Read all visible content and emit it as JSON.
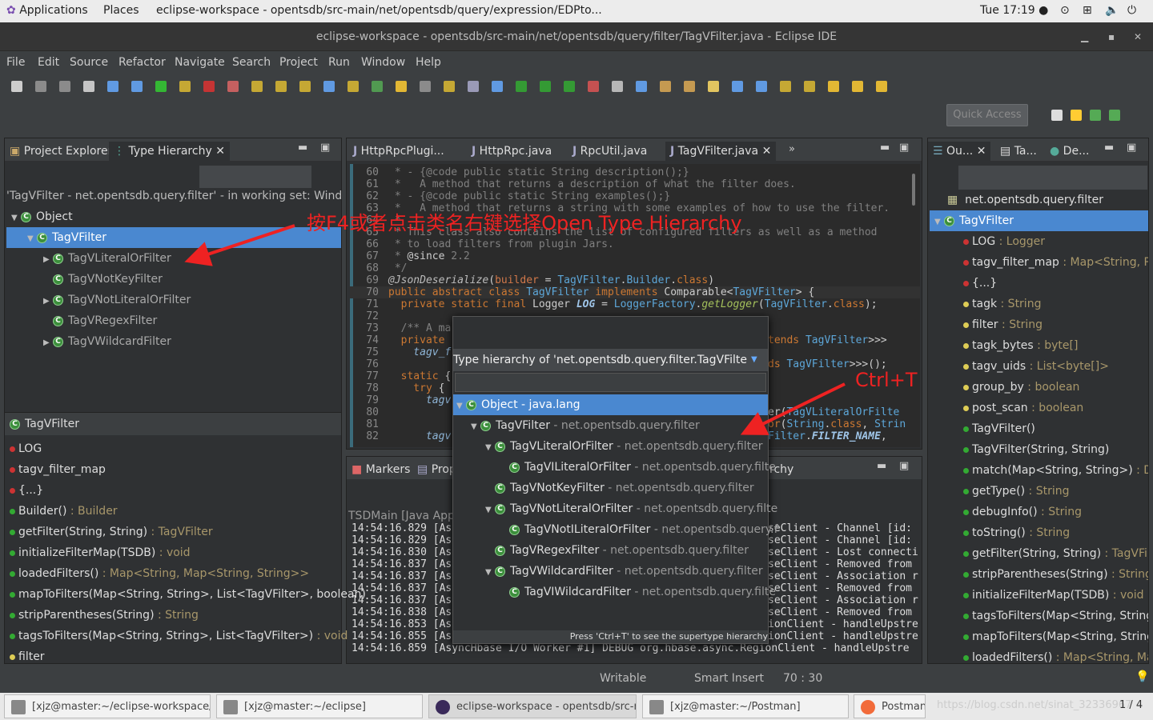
{
  "topbar": {
    "applications": "Applications",
    "places": "Places",
    "window": "eclipse-workspace - opentsdb/src-main/net/opentsdb/query/expression/EDPto...",
    "clock": "Tue 17:19 ●"
  },
  "window": {
    "title": "eclipse-workspace - opentsdb/src-main/net/opentsdb/query/filter/TagVFilter.java - Eclipse IDE"
  },
  "menu": [
    "File",
    "Edit",
    "Source",
    "Refactor",
    "Navigate",
    "Search",
    "Project",
    "Run",
    "Window",
    "Help"
  ],
  "toolbar": {
    "quick_access": "Quick Access"
  },
  "left_panel": {
    "tabs": [
      "Project Explorer",
      "Type Hierarchy"
    ],
    "status": "'TagVFilter - net.opentsdb.query.filter' - in working set: Window W",
    "tree": [
      {
        "label": "Object",
        "depth": 0,
        "exp": "down"
      },
      {
        "label": "TagVFilter",
        "depth": 1,
        "exp": "down",
        "sel": true
      },
      {
        "label": "TagVLiteralOrFilter",
        "depth": 2,
        "exp": "right"
      },
      {
        "label": "TagVNotKeyFilter",
        "depth": 2,
        "exp": ""
      },
      {
        "label": "TagVNotLiteralOrFilter",
        "depth": 2,
        "exp": "right"
      },
      {
        "label": "TagVRegexFilter",
        "depth": 2,
        "exp": ""
      },
      {
        "label": "TagVWildcardFilter",
        "depth": 2,
        "exp": "right"
      }
    ],
    "members_title": "TagVFilter",
    "members": [
      {
        "name": "LOG",
        "type": "",
        "color": "#c33"
      },
      {
        "name": "tagv_filter_map",
        "type": "",
        "color": "#c33"
      },
      {
        "name": "{...}",
        "type": "",
        "color": "#c33"
      },
      {
        "name": "Builder()",
        "type": " : Builder",
        "color": "#3a3"
      },
      {
        "name": "getFilter(String, String)",
        "type": " : TagVFilter",
        "color": "#3a3"
      },
      {
        "name": "initializeFilterMap(TSDB)",
        "type": " : void",
        "color": "#3a3"
      },
      {
        "name": "loadedFilters()",
        "type": " : Map<String, Map<String, String>>",
        "color": "#3a3"
      },
      {
        "name": "mapToFilters(Map<String, String>, List<TagVFilter>, boolean)",
        "type": "",
        "color": "#3a3"
      },
      {
        "name": "stripParentheses(String)",
        "type": " : String",
        "color": "#3a3"
      },
      {
        "name": "tagsToFilters(Map<String, String>, List<TagVFilter>)",
        "type": " : void",
        "color": "#3a3"
      },
      {
        "name": "filter",
        "type": "",
        "color": "#dc5"
      }
    ]
  },
  "editor": {
    "tabs": [
      "HttpRpcPlugi...",
      "HttpRpc.java",
      "RpcUtil.java",
      "TagVFilter.java"
    ],
    "lines": [
      {
        "n": "60",
        "t": [
          [
            "c",
            " * - {@code public static String description();}"
          ]
        ]
      },
      {
        "n": "61",
        "t": [
          [
            "c",
            " *   A method that returns a description of what the filter does."
          ]
        ]
      },
      {
        "n": "62",
        "t": [
          [
            "c",
            " * - {@code public static String examples();}"
          ]
        ]
      },
      {
        "n": "63",
        "t": [
          [
            "c",
            " *   A method that returns a string with some examples of how to use the filter."
          ]
        ]
      },
      {
        "n": "64",
        "t": [
          [
            "c",
            " *"
          ]
        ]
      },
      {
        "n": "65",
        "t": [
          [
            "c",
            " * This class also contains the list of configured filters as well as a method"
          ]
        ]
      },
      {
        "n": "66",
        "t": [
          [
            "c",
            " * to load filters from plugin Jars."
          ]
        ]
      },
      {
        "n": "67",
        "t": [
          [
            "c",
            " * "
          ],
          [
            "p",
            "@since"
          ],
          [
            "c",
            " 2.2"
          ]
        ]
      },
      {
        "n": "68",
        "t": [
          [
            "c",
            " */"
          ]
        ]
      },
      {
        "n": "69",
        "t": [
          [
            "a",
            "@JsonDeserialize"
          ],
          [
            "p",
            "("
          ],
          [
            "par",
            "builder"
          ],
          [
            "p",
            " = "
          ],
          [
            "ty",
            "TagVFilter"
          ],
          [
            "p",
            "."
          ],
          [
            "ty",
            "Builder"
          ],
          [
            "p",
            "."
          ],
          [
            "k",
            "class"
          ],
          [
            "p",
            ")"
          ]
        ]
      },
      {
        "n": "70",
        "t": [
          [
            "k",
            "public abstract class "
          ],
          [
            "ty",
            "TagVFilter"
          ],
          [
            "k",
            " implements "
          ],
          [
            "p",
            "Comparable<"
          ],
          [
            "ty",
            "TagVFilter"
          ],
          [
            "p",
            "> {"
          ]
        ]
      },
      {
        "n": "71",
        "t": [
          [
            "k",
            "  private static final "
          ],
          [
            "p",
            "Logger "
          ],
          [
            "bi",
            "LOG"
          ],
          [
            "p",
            " = "
          ],
          [
            "ty",
            "LoggerFactory"
          ],
          [
            "p",
            "."
          ],
          [
            "f",
            "getLogger"
          ],
          [
            "p",
            "("
          ],
          [
            "ty",
            "TagVFilter"
          ],
          [
            "p",
            "."
          ],
          [
            "k",
            "class"
          ],
          [
            "p",
            ");"
          ]
        ]
      },
      {
        "n": "72",
        "t": []
      },
      {
        "n": "73",
        "t": [
          [
            "c",
            "  /** A ma"
          ]
        ]
      },
      {
        "n": "74",
        "t": [
          [
            "k",
            "  private"
          ]
        ],
        "tail": [
          [
            "k",
            "tends "
          ],
          [
            "ty",
            "TagVFilter"
          ],
          [
            "p",
            ">>>"
          ]
        ]
      },
      {
        "n": "75",
        "t": [
          [
            "iv",
            "    tagv_f"
          ]
        ]
      },
      {
        "n": "76",
        "t": [],
        "tail": [
          [
            "k",
            "ds "
          ],
          [
            "ty",
            "TagVFilter"
          ],
          [
            "p",
            ">>>();"
          ]
        ]
      },
      {
        "n": "77",
        "t": [
          [
            "k",
            "  static"
          ],
          [
            "p",
            " {"
          ]
        ]
      },
      {
        "n": "78",
        "t": [
          [
            "k",
            "    try"
          ],
          [
            "p",
            " {"
          ]
        ]
      },
      {
        "n": "79",
        "t": [
          [
            "iv",
            "      tagv"
          ]
        ]
      },
      {
        "n": "80",
        "t": [],
        "tail": [
          [
            "p",
            "er("
          ],
          [
            "ty",
            "TagVLiteralOrFilte"
          ]
        ]
      },
      {
        "n": "81",
        "t": [],
        "tail": [
          [
            "k",
            "or"
          ],
          [
            "p",
            "("
          ],
          [
            "ty",
            "String"
          ],
          [
            "p",
            "."
          ],
          [
            "k",
            "class"
          ],
          [
            "p",
            ", "
          ],
          [
            "ty",
            "Strin"
          ]
        ]
      },
      {
        "n": "82",
        "t": [
          [
            "iv",
            "      tagv"
          ]
        ],
        "tail": [
          [
            "ty",
            "Filter"
          ],
          [
            "p",
            "."
          ],
          [
            "bi",
            "FILTER_NAME"
          ],
          [
            "p",
            ","
          ]
        ]
      }
    ]
  },
  "console": {
    "tabs": [
      "Markers",
      "Prop"
    ],
    "tab_tail": "rchy",
    "header": "TSDMain [Java Appli",
    "lines": [
      [
        "14:54:16.829 [As",
        "seClient - Channel [id:"
      ],
      [
        "14:54:16.829 [As",
        "seClient - Channel [id:"
      ],
      [
        "14:54:16.830 [As",
        "seClient - Lost connecti"
      ],
      [
        "14:54:16.837 [As",
        "seClient - Removed from"
      ],
      [
        "14:54:16.837 [As",
        "seClient - Association r"
      ],
      [
        "14:54:16.837 [As",
        "seClient - Removed from"
      ],
      [
        "14:54:16.837 [As",
        "seClient - Association r"
      ],
      [
        "14:54:16.838 [As",
        "seClient - Removed from"
      ],
      [
        "14:54:16.853 [As",
        "ionClient - handleUpstre"
      ],
      [
        "14:54:16.855 [As",
        "ionClient - handleUpstre"
      ],
      [
        "14:54:16.859 [AsyncHbase I/O Worker #1] DEBUG org.hbase.async.RegionClient - handleUpstre",
        ""
      ]
    ]
  },
  "popup": {
    "title": "Type hierarchy of 'net.opentsdb.query.filter.TagVFilte",
    "filter_value": "",
    "items": [
      {
        "label": "Object",
        "pkg": " - java.lang",
        "depth": 0,
        "exp": "down",
        "sel": true
      },
      {
        "label": "TagVFilter",
        "pkg": " - net.opentsdb.query.filter",
        "depth": 1,
        "exp": "down"
      },
      {
        "label": "TagVLiteralOrFilter",
        "pkg": " - net.opentsdb.query.filter",
        "depth": 2,
        "exp": "down"
      },
      {
        "label": "TagVILiteralOrFilter",
        "pkg": " - net.opentsdb.query.filte",
        "depth": 3,
        "exp": ""
      },
      {
        "label": "TagVNotKeyFilter",
        "pkg": " - net.opentsdb.query.filter",
        "depth": 2,
        "exp": ""
      },
      {
        "label": "TagVNotLiteralOrFilter",
        "pkg": " - net.opentsdb.query.filte",
        "depth": 2,
        "exp": "down"
      },
      {
        "label": "TagVNotILiteralOrFilter",
        "pkg": " - net.opentsdb.query.f",
        "depth": 3,
        "exp": ""
      },
      {
        "label": "TagVRegexFilter",
        "pkg": " - net.opentsdb.query.filter",
        "depth": 2,
        "exp": ""
      },
      {
        "label": "TagVWildcardFilter",
        "pkg": " - net.opentsdb.query.filter",
        "depth": 2,
        "exp": "down"
      },
      {
        "label": "TagVIWildcardFilter",
        "pkg": " - net.opentsdb.query.filte",
        "depth": 3,
        "exp": ""
      }
    ],
    "footer": "Press 'Ctrl+T' to see the supertype hierarchy"
  },
  "outline": {
    "tabs": [
      "Ou...",
      "Ta...",
      "De..."
    ],
    "package": "net.opentsdb.query.filter",
    "items": [
      {
        "name": "TagVFilter",
        "type": "",
        "color": "",
        "sel": true
      },
      {
        "name": "LOG",
        "type": " : Logger",
        "color": "#c33"
      },
      {
        "name": "tagv_filter_map",
        "type": " : Map<String, Pai",
        "color": "#c33"
      },
      {
        "name": "{...}",
        "type": "",
        "color": "#c33"
      },
      {
        "name": "tagk",
        "type": " : String",
        "color": "#dc5"
      },
      {
        "name": "filter",
        "type": " : String",
        "color": "#dc5"
      },
      {
        "name": "tagk_bytes",
        "type": " : byte[]",
        "color": "#dc5"
      },
      {
        "name": "tagv_uids",
        "type": " : List<byte[]>",
        "color": "#dc5"
      },
      {
        "name": "group_by",
        "type": " : boolean",
        "color": "#dc5"
      },
      {
        "name": "post_scan",
        "type": " : boolean",
        "color": "#dc5"
      },
      {
        "name": "TagVFilter()",
        "type": "",
        "color": "#3a3"
      },
      {
        "name": "TagVFilter(String, String)",
        "type": "",
        "color": "#3a3"
      },
      {
        "name": "match(Map<String, String>)",
        "type": " : Def",
        "color": "#3a3"
      },
      {
        "name": "getType()",
        "type": " : String",
        "color": "#3a3"
      },
      {
        "name": "debugInfo()",
        "type": " : String",
        "color": "#3a3"
      },
      {
        "name": "toString()",
        "type": " : String",
        "color": "#3a3"
      },
      {
        "name": "getFilter(String, String)",
        "type": " : TagVFilt",
        "color": "#3a3"
      },
      {
        "name": "stripParentheses(String)",
        "type": " : String",
        "color": "#3a3"
      },
      {
        "name": "initializeFilterMap(TSDB)",
        "type": " : void",
        "color": "#3a3"
      },
      {
        "name": "tagsToFilters(Map<String, String>",
        "type": "",
        "color": "#3a3"
      },
      {
        "name": "mapToFilters(Map<String, String>",
        "type": "",
        "color": "#3a3"
      },
      {
        "name": "loadedFilters()",
        "type": " : Map<String, Map",
        "color": "#3a3"
      }
    ]
  },
  "status": {
    "writable": "Writable",
    "insert_mode": "Smart Insert",
    "position": "70 : 30"
  },
  "taskbar": {
    "items": [
      "[xjz@master:~/eclipse-workspace/o...",
      "[xjz@master:~/eclipse]",
      "eclipse-workspace - opentsdb/src-m...",
      "[xjz@master:~/Postman]",
      "Postman"
    ],
    "watermark": "https://blog.csdn.net/sinat_32336967",
    "pager": "1 / 4"
  },
  "annotations": {
    "f4_hint": "按F4或者点击类名右键选择Open Type Hierarchy",
    "ctrl_t": "Ctrl+T"
  },
  "colors": {
    "selection": "#4a88d0",
    "annotation": "#ee2222",
    "keyword": "#cc7832",
    "type": "#5da7d9"
  }
}
